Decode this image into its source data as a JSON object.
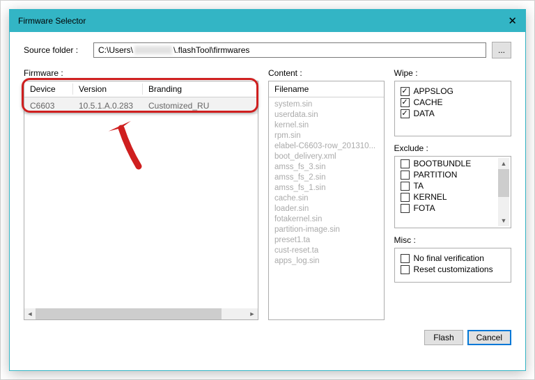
{
  "window": {
    "title": "Firmware Selector",
    "close_glyph": "✕"
  },
  "source": {
    "label": "Source folder :",
    "path_prefix": "C:\\Users\\",
    "path_suffix": "\\.flashTool\\firmwares",
    "browse_label": "..."
  },
  "firmware": {
    "section_label": "Firmware :",
    "headers": {
      "device": "Device",
      "version": "Version",
      "branding": "Branding"
    },
    "rows": [
      {
        "device": "C6603",
        "version": "10.5.1.A.0.283",
        "branding": "Customized_RU"
      }
    ]
  },
  "content": {
    "section_label": "Content :",
    "header": "Filename",
    "files": [
      "system.sin",
      "userdata.sin",
      "kernel.sin",
      "rpm.sin",
      "elabel-C6603-row_201310...",
      "boot_delivery.xml",
      "amss_fs_3.sin",
      "amss_fs_2.sin",
      "amss_fs_1.sin",
      "cache.sin",
      "loader.sin",
      "fotakernel.sin",
      "partition-image.sin",
      "preset1.ta",
      "cust-reset.ta",
      "apps_log.sin"
    ]
  },
  "wipe": {
    "section_label": "Wipe :",
    "items": [
      {
        "label": "APPSLOG",
        "checked": true
      },
      {
        "label": "CACHE",
        "checked": true
      },
      {
        "label": "DATA",
        "checked": true
      }
    ]
  },
  "exclude": {
    "section_label": "Exclude :",
    "items": [
      {
        "label": "BOOTBUNDLE",
        "checked": false
      },
      {
        "label": "PARTITION",
        "checked": false
      },
      {
        "label": "TA",
        "checked": false
      },
      {
        "label": "KERNEL",
        "checked": false
      },
      {
        "label": "FOTA",
        "checked": false
      }
    ]
  },
  "misc": {
    "section_label": "Misc :",
    "items": [
      {
        "label": "No final verification",
        "checked": false
      },
      {
        "label": "Reset customizations",
        "checked": false
      }
    ]
  },
  "footer": {
    "flash": "Flash",
    "cancel": "Cancel"
  },
  "scroll_glyphs": {
    "left": "◄",
    "right": "►",
    "up": "▲",
    "down": "▼"
  }
}
